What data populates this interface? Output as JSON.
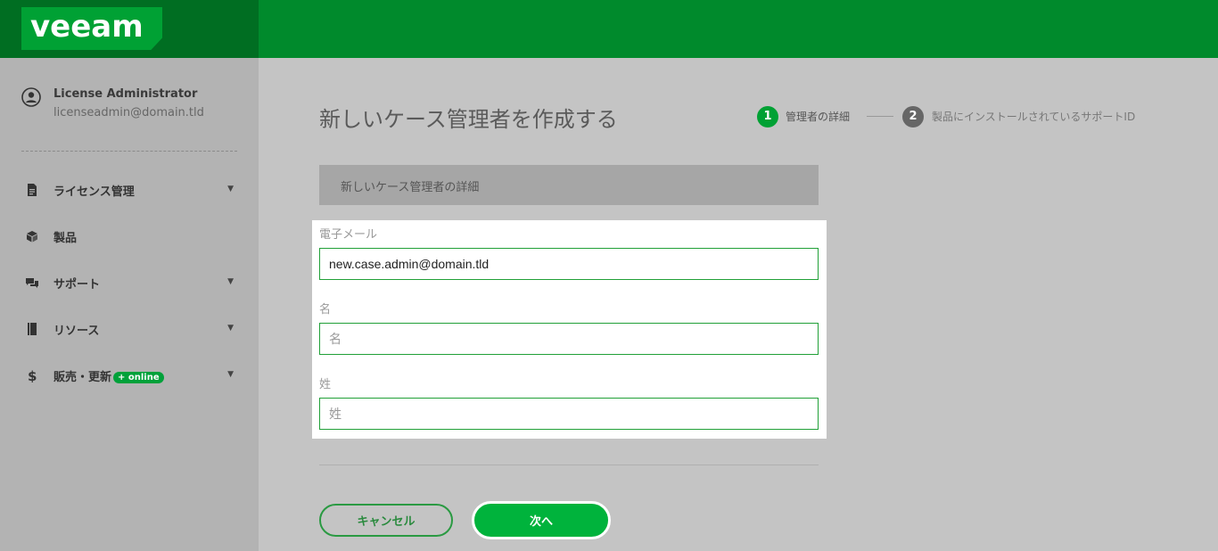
{
  "brand": {
    "logo_text": "veeam",
    "accent": "#00a134",
    "topbar_color": "#008a2c"
  },
  "user": {
    "name": "License Administrator",
    "email": "licenseadmin@domain.tld",
    "icon": "user-circle-icon"
  },
  "nav": {
    "items": [
      {
        "label": "ライセンス管理",
        "icon": "document-icon",
        "has_caret": true
      },
      {
        "label": "製品",
        "icon": "cube-icon",
        "has_caret": false
      },
      {
        "label": "サポート",
        "icon": "chat-bubbles-icon",
        "has_caret": true
      },
      {
        "label": "リソース",
        "icon": "book-icon",
        "has_caret": true
      },
      {
        "label": "販売・更新",
        "badge": "+ online",
        "icon": "dollar-icon",
        "has_caret": true
      }
    ],
    "caret": "▼"
  },
  "page": {
    "title": "新しいケース管理者を作成する"
  },
  "steps": [
    {
      "number": "1",
      "label": "管理者の詳細",
      "active": true
    },
    {
      "number": "2",
      "label": "製品にインストールされているサポートID",
      "active": false
    }
  ],
  "section": {
    "header": "新しいケース管理者の詳細"
  },
  "form": {
    "email": {
      "label": "電子メール",
      "value": "new.case.admin@domain.tld"
    },
    "first_name": {
      "label": "名",
      "placeholder": "名",
      "value": ""
    },
    "last_name": {
      "label": "姓",
      "placeholder": "姓",
      "value": ""
    }
  },
  "buttons": {
    "cancel": "キャンセル",
    "next": "次へ"
  }
}
